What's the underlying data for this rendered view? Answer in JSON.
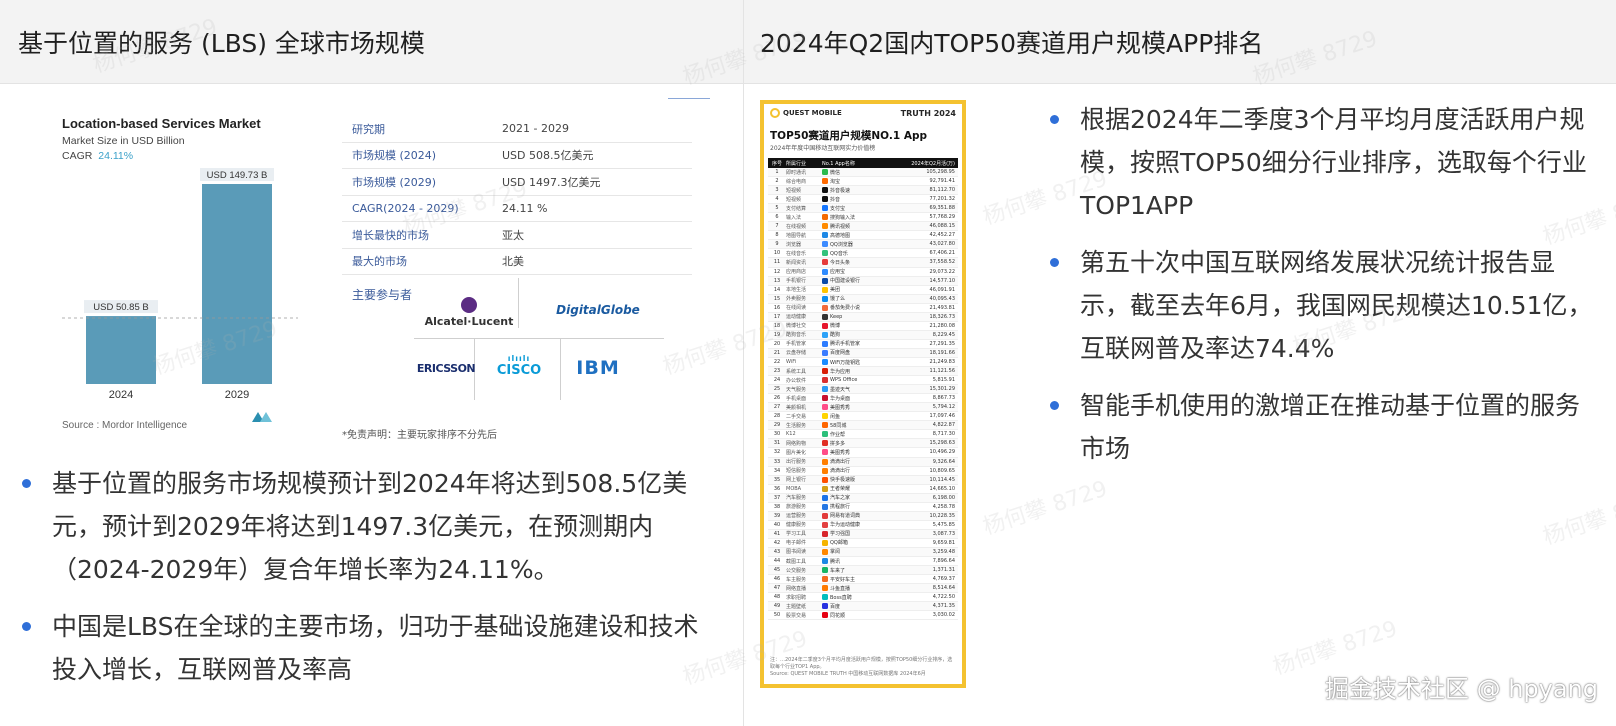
{
  "left_header": "基于位置的服务 (LBS) 全球市场规模",
  "right_header": "2024年Q2国内TOP50赛道用户规模APP排名",
  "figure": {
    "title": "Location-based Services Market",
    "subtitle": "Market Size in USD Billion",
    "cagr_label": "CAGR",
    "cagr_value": "24.11%",
    "source": "Source : Mordor Intelligence",
    "bars": [
      {
        "year": "2024",
        "label": "USD 50.85 B",
        "value": 50.85
      },
      {
        "year": "2029",
        "label": "USD 149.73 B",
        "value": 149.73
      }
    ],
    "bar_color": "#5a9bb8",
    "info_rows": [
      {
        "k": "研究期",
        "v": "2021 - 2029"
      },
      {
        "k": "市场规模 (2024)",
        "v": "USD 508.5亿美元"
      },
      {
        "k": "市场规模 (2029)",
        "v": "USD 1497.3亿美元"
      },
      {
        "k": "CAGR(2024 - 2029)",
        "v": "24.11 %"
      },
      {
        "k": "增长最快的市场",
        "v": "亚太"
      },
      {
        "k": "最大的市场",
        "v": "北美"
      }
    ],
    "players_label": "主要参与者",
    "logos": [
      "Alcatel·Lucent",
      "DigitalGlobe",
      "ERICSSON",
      "CISCO",
      "IBM"
    ],
    "disclaimer": "*免责声明：主要玩家排序不分先后"
  },
  "left_bullets": [
    "基于位置的服务市场规模预计到2024年将达到508.5亿美元，预计到2029年将达到1497.3亿美元，在预测期内（2024-2029年）复合年增长率为24.11%。",
    "中国是LBS在全球的主要市场，归功于基础设施建设和技术投入增长，互联网普及率高"
  ],
  "right_bullets": [
    "根据2024年二季度3个月平均月度活跃用户规模，按照TOP50细分行业排序，选取每个行业TOP1APP",
    "第五十次中国互联网络发展状况统计报告显示，截至去年6月，我国网民规模达10.51亿，互联网普及率达74.4%",
    "智能手机使用的激增正在推动基于位置的服务市场"
  ],
  "poster": {
    "brand_left": "QUEST MOBILE",
    "brand_right": "TRUTH 2024",
    "title": "TOP50赛道用户规模NO.1 App",
    "subtitle": "2024年年度中国移动互联网实力价值榜",
    "columns": [
      "序号",
      "所属行业",
      "No.1 App名称",
      "2024年Q2月活(万)"
    ],
    "rows": [
      [
        "1",
        "即时通讯",
        "微信",
        "105,298.95",
        "#2dbb4e"
      ],
      [
        "2",
        "综合电商",
        "淘宝",
        "92,791.41",
        "#ff6a00"
      ],
      [
        "3",
        "短视频",
        "抖音极速",
        "81,112.70",
        "#111111"
      ],
      [
        "4",
        "短视频",
        "抖音",
        "77,201.32",
        "#111111"
      ],
      [
        "5",
        "支付结算",
        "支付宝",
        "69,351.88",
        "#1677ff"
      ],
      [
        "6",
        "输入法",
        "搜狗输入法",
        "57,768.29",
        "#f56a00"
      ],
      [
        "7",
        "在线视频",
        "腾讯视频",
        "46,088.15",
        "#ff8a00"
      ],
      [
        "8",
        "地图导航",
        "高德地图",
        "42,452.27",
        "#1e88e5"
      ],
      [
        "9",
        "浏览器",
        "QQ浏览器",
        "43,027.80",
        "#3d8bff"
      ],
      [
        "10",
        "在线音乐",
        "QQ音乐",
        "67,406.21",
        "#31c27c"
      ],
      [
        "11",
        "新闻资讯",
        "今日头条",
        "37,558.52",
        "#e63b3b"
      ],
      [
        "12",
        "应用商店",
        "应用宝",
        "29,073.22",
        "#2f8bff"
      ],
      [
        "13",
        "手机银行",
        "中国建设银行",
        "14,577.10",
        "#0a4aa8"
      ],
      [
        "14",
        "本地生活",
        "美团",
        "46,091.91",
        "#ffc300"
      ],
      [
        "15",
        "外卖服务",
        "饿了么",
        "40,095.43",
        "#0b8df0"
      ],
      [
        "16",
        "在线阅读",
        "番茄免费小说",
        "21,493.81",
        "#f26b3a"
      ],
      [
        "17",
        "运动健康",
        "Keep",
        "18,326.73",
        "#333333"
      ],
      [
        "18",
        "微博社交",
        "微博",
        "21,280.08",
        "#e6162d"
      ],
      [
        "19",
        "酷狗音乐",
        "酷狗",
        "8,229.45",
        "#2ca2f8"
      ],
      [
        "20",
        "手机管家",
        "腾讯手机管家",
        "27,291.35",
        "#2e7dff"
      ],
      [
        "21",
        "云盘存储",
        "百度网盘",
        "18,191.66",
        "#3a7cff"
      ],
      [
        "22",
        "WiFi",
        "WiFi万能钥匙",
        "21,249.83",
        "#1a8cff"
      ],
      [
        "23",
        "系统工具",
        "华为应用",
        "11,121.56",
        "#d81e06"
      ],
      [
        "24",
        "办公软件",
        "WPS Office",
        "5,815.91",
        "#d92f2f"
      ],
      [
        "25",
        "天气服务",
        "墨迹天气",
        "15,301.29",
        "#2b9bf4"
      ],
      [
        "26",
        "手机桌面",
        "华为桌面",
        "8,867.73",
        "#c8102e"
      ],
      [
        "27",
        "美颜相机",
        "美图秀秀",
        "5,794.12",
        "#ff4d88"
      ],
      [
        "28",
        "二手交易",
        "闲鱼",
        "17,097.46",
        "#ffd400"
      ],
      [
        "29",
        "生活服务",
        "58同城",
        "4,822.87",
        "#ff6600"
      ],
      [
        "30",
        "K12",
        "作业帮",
        "8,717.30",
        "#2bbf7a"
      ],
      [
        "31",
        "网络购物",
        "拼多多",
        "15,298.63",
        "#e02e24"
      ],
      [
        "32",
        "图片美化",
        "美图秀秀",
        "10,496.29",
        "#ff4d88"
      ],
      [
        "33",
        "出行服务",
        "滴滴出行",
        "9,326.64",
        "#ff7f00"
      ],
      [
        "34",
        "短信服务",
        "滴滴出行",
        "10,809.65",
        "#ff7f00"
      ],
      [
        "35",
        "网上银行",
        "快手极速版",
        "10,114.45",
        "#ff5000"
      ],
      [
        "36",
        "MOBA",
        "王者荣耀",
        "14,665.10",
        "#d4a017"
      ],
      [
        "37",
        "汽车服务",
        "汽车之家",
        "6,198.00",
        "#1a73e8"
      ],
      [
        "38",
        "旅游服务",
        "携程旅行",
        "4,258.78",
        "#2577e3"
      ],
      [
        "39",
        "运营服务",
        "网易有道词典",
        "10,228.35",
        "#e23b3b"
      ],
      [
        "40",
        "健康服务",
        "华为运动健康",
        "5,475.85",
        "#e34040"
      ],
      [
        "41",
        "学习工具",
        "学习强国",
        "3,087.73",
        "#d8262d"
      ],
      [
        "42",
        "电子邮件",
        "QQ邮箱",
        "9,659.81",
        "#f5b400"
      ],
      [
        "43",
        "图书阅读",
        "掌阅",
        "3,259.48",
        "#ff8800"
      ],
      [
        "44",
        "截图工具",
        "腾讯",
        "7,896.64",
        "#1e88e5"
      ],
      [
        "45",
        "公交服务",
        "车来了",
        "1,371.31",
        "#18b566"
      ],
      [
        "46",
        "车主服务",
        "平安好车主",
        "4,769.37",
        "#f26b21"
      ],
      [
        "47",
        "网络直播",
        "斗鱼直播",
        "8,514.64",
        "#ff7a00"
      ],
      [
        "48",
        "求职招聘",
        "Boss直聘",
        "4,722.50",
        "#00bebd"
      ],
      [
        "49",
        "主题壁纸",
        "百度",
        "4,371.35",
        "#2932e1"
      ],
      [
        "50",
        "股票交易",
        "同花顺",
        "3,030.02",
        "#e60012"
      ]
    ],
    "note": "注：…2024年二季度3个月平均月度活跃用户规模，按照TOP50细分行业排序，选取每个行业TOP1 App。",
    "source": "Source: QUEST MOBILE TRUTH 中国移动互联网数据库 2024年6月"
  },
  "watermark": "杨何攀 8729",
  "credit": "掘金技术社区 @ hpyang"
}
